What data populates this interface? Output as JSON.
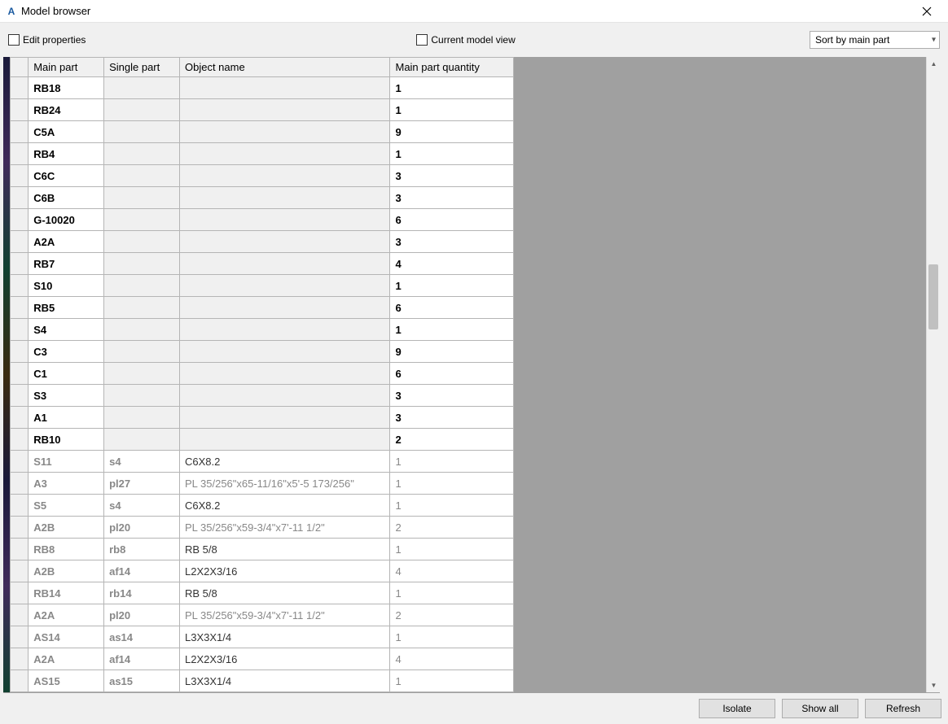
{
  "window": {
    "title": "Model browser"
  },
  "toolbar": {
    "edit_properties_label": "Edit properties",
    "current_model_view_label": "Current model view",
    "sort_dropdown_value": "Sort by main part"
  },
  "table": {
    "columns": {
      "main_part": "Main part",
      "single_part": "Single part",
      "object_name": "Object name",
      "main_part_quantity": "Main part quantity"
    },
    "rows": [
      {
        "mp": "RB18",
        "sp": "",
        "obj": "",
        "qty": "1",
        "bold": true,
        "obj_gray": false
      },
      {
        "mp": "RB24",
        "sp": "",
        "obj": "",
        "qty": "1",
        "bold": true,
        "obj_gray": false
      },
      {
        "mp": "C5A",
        "sp": "",
        "obj": "",
        "qty": "9",
        "bold": true,
        "obj_gray": false
      },
      {
        "mp": "RB4",
        "sp": "",
        "obj": "",
        "qty": "1",
        "bold": true,
        "obj_gray": false
      },
      {
        "mp": "C6C",
        "sp": "",
        "obj": "",
        "qty": "3",
        "bold": true,
        "obj_gray": false
      },
      {
        "mp": "C6B",
        "sp": "",
        "obj": "",
        "qty": "3",
        "bold": true,
        "obj_gray": false
      },
      {
        "mp": "G-10020",
        "sp": "",
        "obj": "",
        "qty": "6",
        "bold": true,
        "obj_gray": false
      },
      {
        "mp": "A2A",
        "sp": "",
        "obj": "",
        "qty": "3",
        "bold": true,
        "obj_gray": false
      },
      {
        "mp": "RB7",
        "sp": "",
        "obj": "",
        "qty": "4",
        "bold": true,
        "obj_gray": false
      },
      {
        "mp": "S10",
        "sp": "",
        "obj": "",
        "qty": "1",
        "bold": true,
        "obj_gray": false
      },
      {
        "mp": "RB5",
        "sp": "",
        "obj": "",
        "qty": "6",
        "bold": true,
        "obj_gray": false
      },
      {
        "mp": "S4",
        "sp": "",
        "obj": "",
        "qty": "1",
        "bold": true,
        "obj_gray": false
      },
      {
        "mp": "C3",
        "sp": "",
        "obj": "",
        "qty": "9",
        "bold": true,
        "obj_gray": false
      },
      {
        "mp": "C1",
        "sp": "",
        "obj": "",
        "qty": "6",
        "bold": true,
        "obj_gray": false
      },
      {
        "mp": "S3",
        "sp": "",
        "obj": "",
        "qty": "3",
        "bold": true,
        "obj_gray": false
      },
      {
        "mp": "A1",
        "sp": "",
        "obj": "",
        "qty": "3",
        "bold": true,
        "obj_gray": false
      },
      {
        "mp": "RB10",
        "sp": "",
        "obj": "",
        "qty": "2",
        "bold": true,
        "obj_gray": false
      },
      {
        "mp": "S11",
        "sp": "s4",
        "obj": "C6X8.2",
        "qty": "1",
        "bold": false,
        "obj_gray": false
      },
      {
        "mp": "A3",
        "sp": "pl27",
        "obj": "PL 35/256\"x65-11/16\"x5'-5 173/256\"",
        "qty": "1",
        "bold": false,
        "obj_gray": true
      },
      {
        "mp": "S5",
        "sp": "s4",
        "obj": "C6X8.2",
        "qty": "1",
        "bold": false,
        "obj_gray": false
      },
      {
        "mp": "A2B",
        "sp": "pl20",
        "obj": "PL 35/256\"x59-3/4\"x7'-11 1/2\"",
        "qty": "2",
        "bold": false,
        "obj_gray": true
      },
      {
        "mp": "RB8",
        "sp": "rb8",
        "obj": "RB 5/8",
        "qty": "1",
        "bold": false,
        "obj_gray": false
      },
      {
        "mp": "A2B",
        "sp": "af14",
        "obj": "L2X2X3/16",
        "qty": "4",
        "bold": false,
        "obj_gray": false
      },
      {
        "mp": "RB14",
        "sp": "rb14",
        "obj": "RB 5/8",
        "qty": "1",
        "bold": false,
        "obj_gray": false
      },
      {
        "mp": "A2A",
        "sp": "pl20",
        "obj": "PL 35/256\"x59-3/4\"x7'-11 1/2\"",
        "qty": "2",
        "bold": false,
        "obj_gray": true
      },
      {
        "mp": "AS14",
        "sp": "as14",
        "obj": "L3X3X1/4",
        "qty": "1",
        "bold": false,
        "obj_gray": false
      },
      {
        "mp": "A2A",
        "sp": "af14",
        "obj": "L2X2X3/16",
        "qty": "4",
        "bold": false,
        "obj_gray": false
      },
      {
        "mp": "AS15",
        "sp": "as15",
        "obj": "L3X3X1/4",
        "qty": "1",
        "bold": false,
        "obj_gray": false
      }
    ]
  },
  "footer": {
    "isolate": "Isolate",
    "show_all": "Show all",
    "refresh": "Refresh"
  }
}
